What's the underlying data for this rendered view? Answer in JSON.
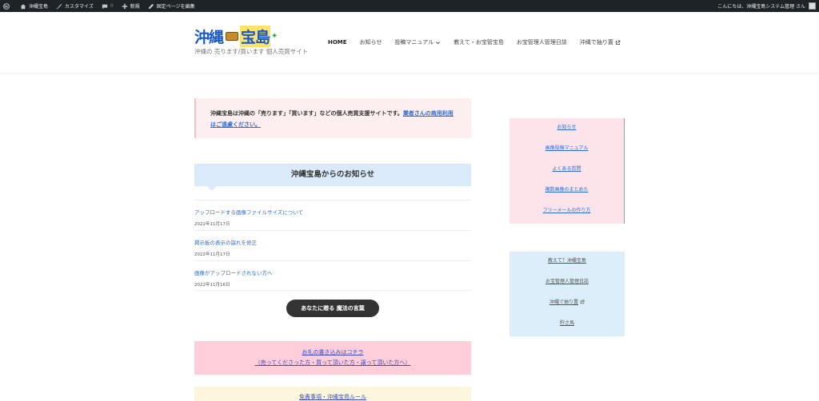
{
  "adminbar": {
    "site_name": "沖縄宝島",
    "customize": "カスタマイズ",
    "comments_count": "0",
    "new": "新規",
    "edit_page": "固定ページを編集",
    "greeting": "こんにちは、沖縄宝島システム管理 さん"
  },
  "header": {
    "logo_part1": "沖縄",
    "logo_part2": "宝島",
    "tagline": "沖縄の 売ります/買います 個人売買サイト",
    "nav": [
      "HOME",
      "お知らせ",
      "投稿マニュアル",
      "教えて・お宝管宝島",
      "お宝管理人管理日誌",
      "沖縄で抽り置"
    ]
  },
  "notice": {
    "text": "沖縄宝島は沖縄の「売ります」「買います」などの個人売買支援サイトです。",
    "link": "業者さんの商用利用はご遠慮ください。"
  },
  "news": {
    "heading": "沖縄宝島からのお知らせ",
    "items": [
      {
        "title": "アップロードする画像ファイルサイズについて",
        "date": "2022年11月17日"
      },
      {
        "title": "掲示板の表示の崩れを修正",
        "date": "2022年11月17日"
      },
      {
        "title": "画像がアップロードされない方へ",
        "date": "2022年11月16日"
      }
    ]
  },
  "magic_button": "あなたに贈る 魔法の言葉",
  "pink_box": {
    "line1": "お礼の書き込みはコチラ",
    "line2": "（売ってくださった方・買って頂いた方・譲って頂いた方へ）"
  },
  "yellow_box": {
    "link": "免責事項・沖縄宝島ルール"
  },
  "sidebar1": {
    "links": [
      "お知らせ",
      "画像投稿マニュアル",
      "よくある質問",
      "複数画像のまとめた",
      "フリーメールの作り方"
    ]
  },
  "sidebar2": {
    "links": [
      "教えて？沖縄宝島",
      "お宝管理人管理日誌",
      "沖縄で抽り置",
      "貯之馬"
    ]
  },
  "colors": {
    "accent_blue": "#2d6bd6",
    "admin_bar": "#1d2327",
    "notice_bg": "#fdeff0",
    "news_head_bg": "#dbeafb",
    "pink_box_bg": "#fecfdb",
    "yellow_box_bg": "#fcf6dc",
    "side1_bg": "#fde4ea",
    "side2_bg": "#dbeefa"
  },
  "icons": {
    "wp_logo": "wordpress-icon",
    "home": "home-icon",
    "customize": "brush-icon",
    "comments": "comment-icon",
    "new": "plus-icon",
    "edit": "pencil-icon",
    "chevron": "chevron-down-icon",
    "external": "external-link-icon"
  }
}
